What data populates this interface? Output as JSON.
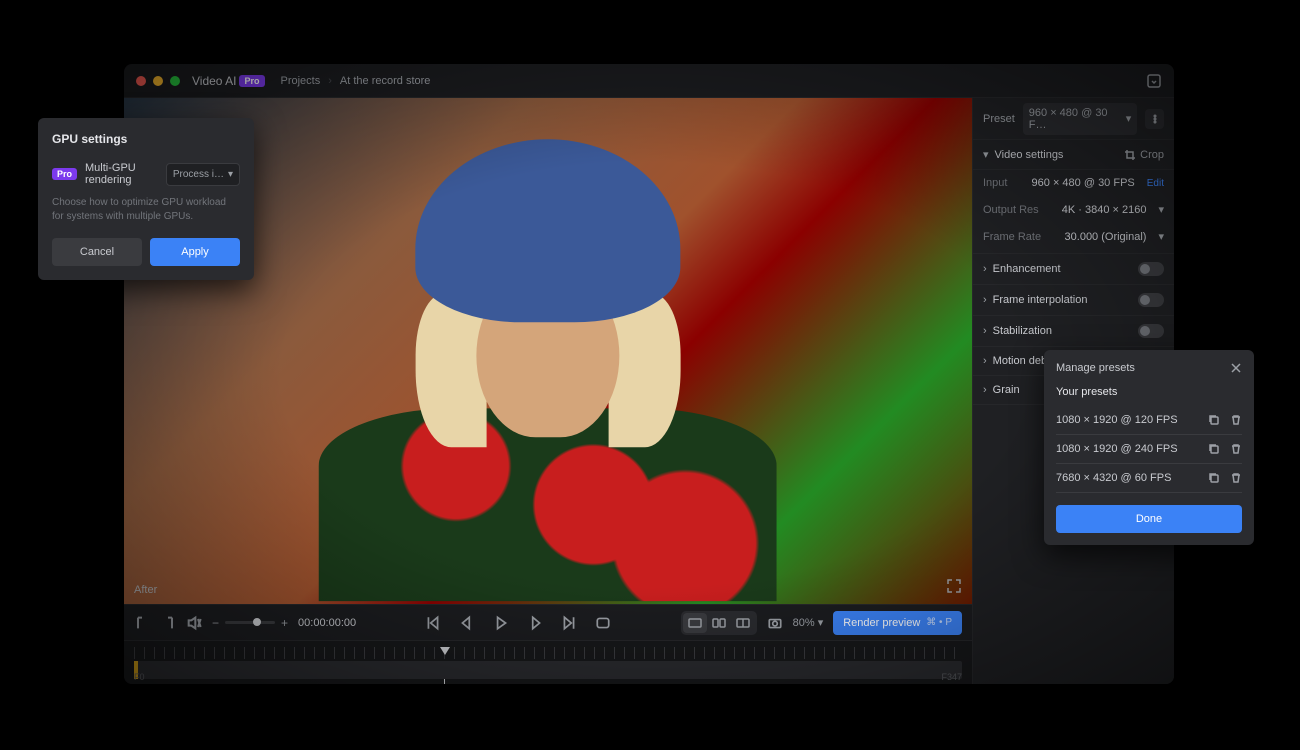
{
  "app": {
    "name": "Video AI",
    "edition": "Pro"
  },
  "breadcrumb": {
    "root": "Projects",
    "item": "At the record store"
  },
  "viewer": {
    "after_label": "After",
    "timecode": "00:00:00:00"
  },
  "transport": {
    "zoom_percent": "80%",
    "render_label": "Render preview",
    "render_hint": "⌘ • P"
  },
  "timeline": {
    "start": "F0",
    "end": "F347"
  },
  "sidebar": {
    "preset_label": "Preset",
    "preset_value": "960 × 480 @ 30 F…",
    "video_settings_label": "Video settings",
    "crop_label": "Crop",
    "fields": {
      "input_label": "Input",
      "input_value": "960 × 480 @ 30 FPS",
      "edit_label": "Edit",
      "output_label": "Output Res",
      "output_value": "4K · 3840 × 2160",
      "fps_label": "Frame Rate",
      "fps_value": "30.000 (Original)"
    },
    "sections": {
      "enhancement": "Enhancement",
      "frame_interpolation": "Frame interpolation",
      "stabilization": "Stabilization",
      "motion_deblur": "Motion deblur",
      "grain": "Grain"
    }
  },
  "gpu_modal": {
    "title": "GPU settings",
    "pro_badge": "Pro",
    "setting_label": "Multi-GPU rendering",
    "select_value": "Process i…",
    "help": "Choose how to optimize GPU workload for systems with multiple GPUs.",
    "cancel": "Cancel",
    "apply": "Apply"
  },
  "presets_pop": {
    "title": "Manage presets",
    "your_presets": "Your presets",
    "items": [
      "1080 × 1920 @ 120 FPS",
      "1080 × 1920 @ 240 FPS",
      "7680 × 4320 @ 60 FPS"
    ],
    "done": "Done"
  }
}
